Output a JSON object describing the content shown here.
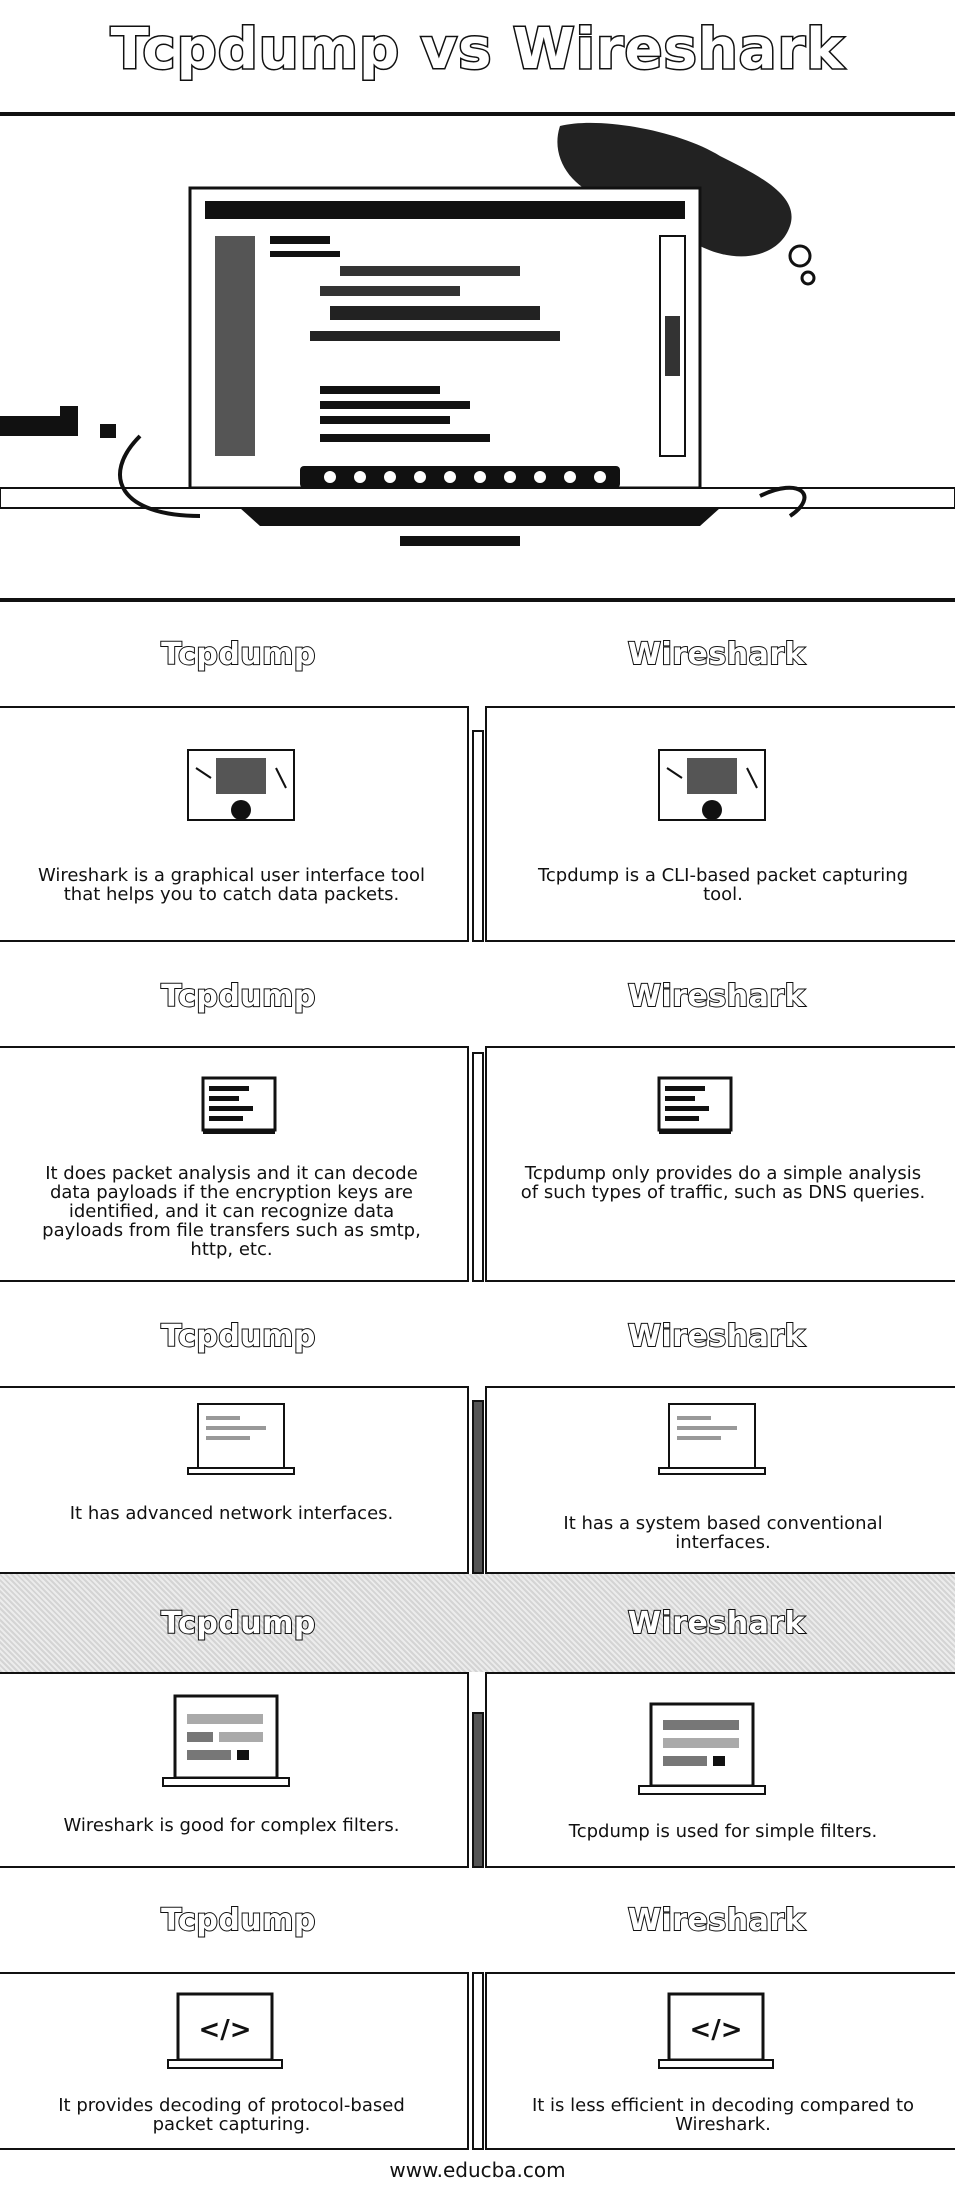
{
  "title": "Tcpdump vs Wireshark",
  "columns": {
    "left": "Tcpdump",
    "right": "Wireshark"
  },
  "rows": [
    {
      "left_text": "Wireshark is a graphical user interface tool that helps you to catch data packets.",
      "right_text": "Tcpdump is a CLI-based packet capturing tool.",
      "icon": "computer-desk-icon"
    },
    {
      "left_text": "It does packet analysis and it can decode data payloads if the encryption keys are identified, and it can recognize data payloads from file transfers such as smtp, http, etc.",
      "right_text": "Tcpdump only provides do a simple analysis of such types of traffic, such as DNS queries.",
      "icon": "document-screen-icon"
    },
    {
      "left_text": "It has advanced network interfaces.",
      "right_text": "It has a system based conventional interfaces.",
      "icon": "laptop-icon"
    },
    {
      "left_text": "Wireshark is good for complex filters.",
      "right_text": "Tcpdump is used for simple filters.",
      "icon": "laptop-filters-icon"
    },
    {
      "left_text": "It provides decoding of protocol-based packet capturing.",
      "right_text": "It is less efficient in decoding compared to Wireshark.",
      "icon": "code-laptop-icon"
    }
  ],
  "footer": "www.educba.com"
}
